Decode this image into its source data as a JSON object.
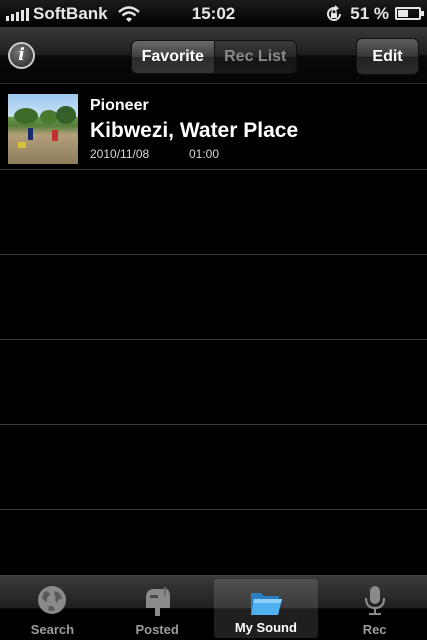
{
  "status_bar": {
    "carrier": "SoftBank",
    "time": "15:02",
    "battery_text": "51 %",
    "battery_level": 0.51
  },
  "nav": {
    "info_label": "i",
    "segments": [
      "Favorite",
      "Rec List"
    ],
    "active_segment": "Favorite",
    "edit_label": "Edit"
  },
  "list": {
    "items": [
      {
        "artist": "Pioneer",
        "title": "Kibwezi, Water Place",
        "date": "2010/11/08",
        "duration": "01:00"
      }
    ]
  },
  "tab_bar": {
    "tabs": [
      {
        "label": "Search",
        "icon": "globe-icon"
      },
      {
        "label": "Posted",
        "icon": "mailbox-icon"
      },
      {
        "label": "My Sound",
        "icon": "folder-icon"
      },
      {
        "label": "Rec",
        "icon": "microphone-icon"
      }
    ],
    "active_tab": "My Sound"
  },
  "colors": {
    "background": "#000000",
    "separator": "#3c3c3c",
    "active_folder_blue": "#3ea2e8"
  }
}
